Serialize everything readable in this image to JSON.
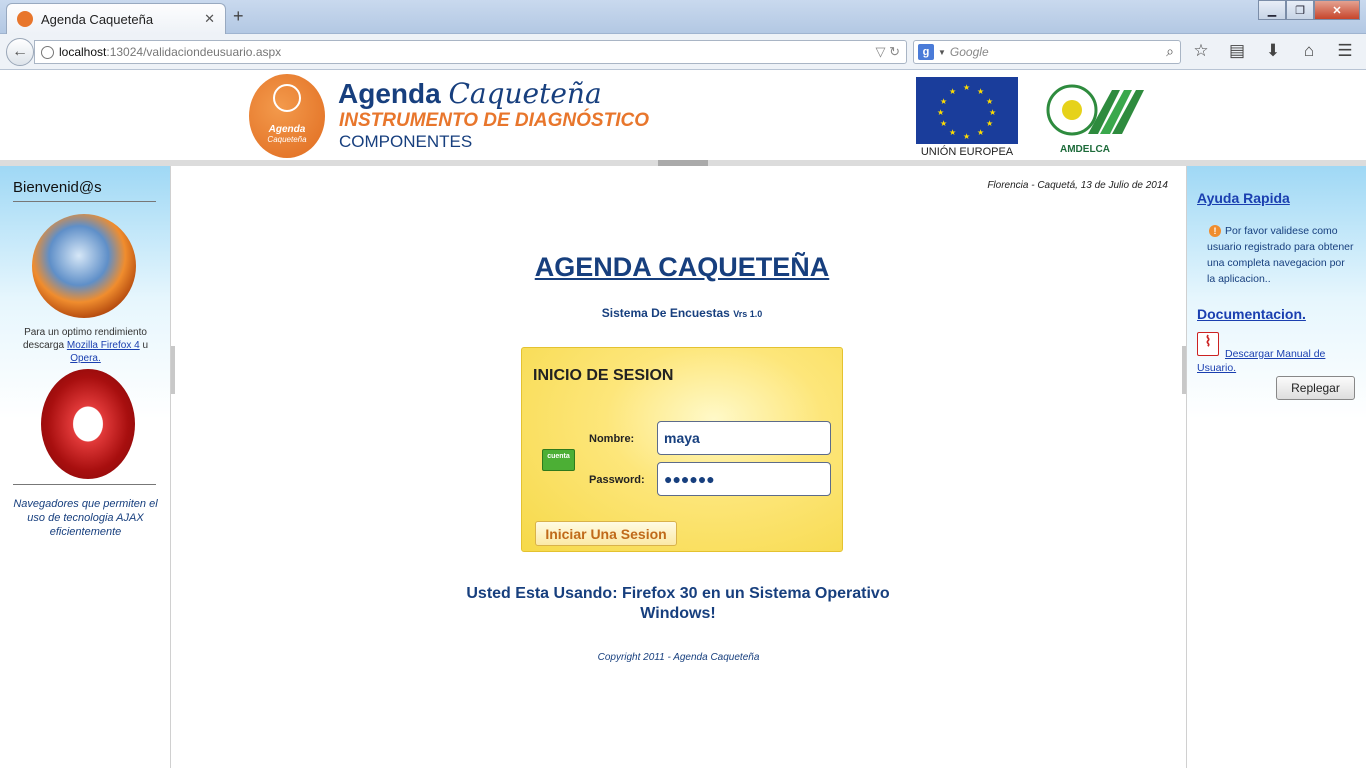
{
  "browser": {
    "tab_title": "Agenda Caqueteña",
    "new_tab": "+",
    "tab_close": "✕",
    "url_host": "localhost",
    "url_rest": ":13024/validaciondeusuario.aspx",
    "search_placeholder": "Google",
    "window_controls": {
      "minimize": "▁",
      "maximize": "❐",
      "close": "✕"
    }
  },
  "header": {
    "brand_word1": "Agenda",
    "brand_word2": "Caqueteña",
    "subtitle": "INSTRUMENTO DE DIAGNÓSTICO",
    "section": "COMPONENTES",
    "logo_line1": "Agenda",
    "logo_line2": "Caqueteña",
    "eu_label": "UNIÓN EUROPEA",
    "partner_label": "AMDELCA"
  },
  "left_sidebar": {
    "welcome": "Bienvenid@s",
    "recommend_prefix": "Para un optimo rendimiento descarga",
    "firefox_link": "Mozilla Firefox 4",
    "connector": "u",
    "opera_link": "Opera.",
    "browsers_note": "Navegadores que permiten el uso de tecnologia AJAX eficientemente"
  },
  "main": {
    "date": "Florencia - Caquetá, 13 de Julio de 2014",
    "title": "AGENDA CAQUETEÑA",
    "system_name": "Sistema De Encuestas",
    "version": "Vrs 1.0",
    "login": {
      "title": "INICIO DE SESION",
      "card_label": "cuenta",
      "user_label": "Nombre:",
      "user_value": "maya",
      "pass_label": "Password:",
      "pass_value": "●●●●●●",
      "submit": "Iniciar Una Sesion"
    },
    "browser_info": "Usted Esta Usando: Firefox 30 en un Sistema Operativo Windows!",
    "copyright": "Copyright 2011 - Agenda Caqueteña"
  },
  "right_sidebar": {
    "help_title": "Ayuda Rapida",
    "help_text": "Por favor validese como usuario registrado para obtener una completa navegacion por la aplicacion..",
    "doc_title": "Documentacion.",
    "manual_link": "Descargar Manual de Usuario.",
    "collapse_button": "Replegar"
  },
  "colors": {
    "brand_blue": "#173f7e",
    "brand_orange": "#e8762c",
    "login_yellow": "#fde67a",
    "sidebar_blue": "#9fd8f5"
  }
}
